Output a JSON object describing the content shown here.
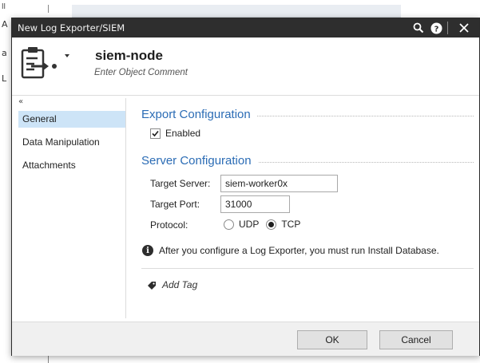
{
  "background": {
    "frag_ii": "ll",
    "frag_a1": "A",
    "frag_a2": "a",
    "frag_l": "L"
  },
  "titlebar": {
    "title": "New Log Exporter/SIEM",
    "icons": [
      "search-icon",
      "help-icon",
      "close-icon"
    ]
  },
  "header": {
    "object_name": "siem-node",
    "comment_placeholder": "Enter Object Comment"
  },
  "sidebar": {
    "collapse_glyph": "«",
    "items": [
      {
        "label": "General",
        "active": true
      },
      {
        "label": "Data Manipulation",
        "active": false
      },
      {
        "label": "Attachments",
        "active": false
      }
    ]
  },
  "export_config": {
    "title": "Export Configuration",
    "enabled_label": "Enabled",
    "enabled": true
  },
  "server_config": {
    "title": "Server Configuration",
    "target_server_label": "Target Server:",
    "target_server_value": "siem-worker0x",
    "target_port_label": "Target Port:",
    "target_port_value": "31000",
    "protocol_label": "Protocol:",
    "protocol_options": [
      "UDP",
      "TCP"
    ],
    "protocol_selected": "TCP"
  },
  "info_message": "After you configure a Log Exporter, you must run Install Database.",
  "add_tag_label": "Add Tag",
  "footer": {
    "ok_label": "OK",
    "cancel_label": "Cancel"
  },
  "colors": {
    "titlebar_bg": "#2e2e2e",
    "section_title": "#2b6cb5",
    "active_nav_bg": "#cde4f7"
  }
}
